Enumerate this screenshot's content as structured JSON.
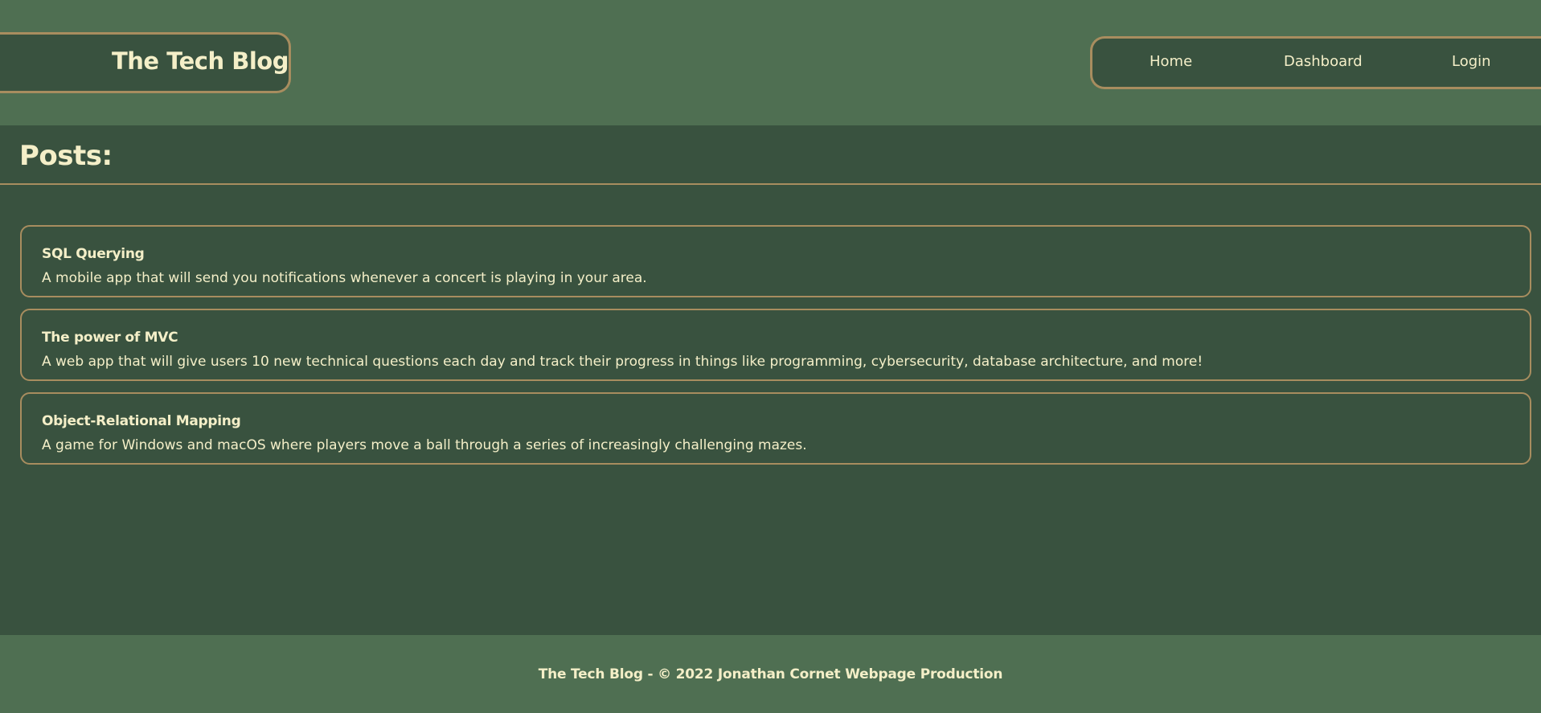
{
  "header": {
    "site_title": "The Tech Blog",
    "nav": {
      "home": "Home",
      "dashboard": "Dashboard",
      "login": "Login"
    }
  },
  "main": {
    "heading": "Posts:",
    "posts": [
      {
        "title": "SQL Querying",
        "description": "A mobile app that will send you notifications whenever a concert is playing in your area."
      },
      {
        "title": "The power of MVC",
        "description": "A web app that will give users 10 new technical questions each day and track their progress in things like programming, cybersecurity, database architecture, and more!"
      },
      {
        "title": "Object-Relational Mapping",
        "description": "A game for Windows and macOS where players move a ball through a series of increasingly challenging mazes."
      }
    ]
  },
  "footer": {
    "text": "The Tech Blog - © 2022 Jonathan Cornet Webpage Production"
  },
  "colors": {
    "header_bg": "#4f6f52",
    "page_bg": "#39523f",
    "accent_border": "#a88d5f",
    "text": "#f4efc8"
  }
}
